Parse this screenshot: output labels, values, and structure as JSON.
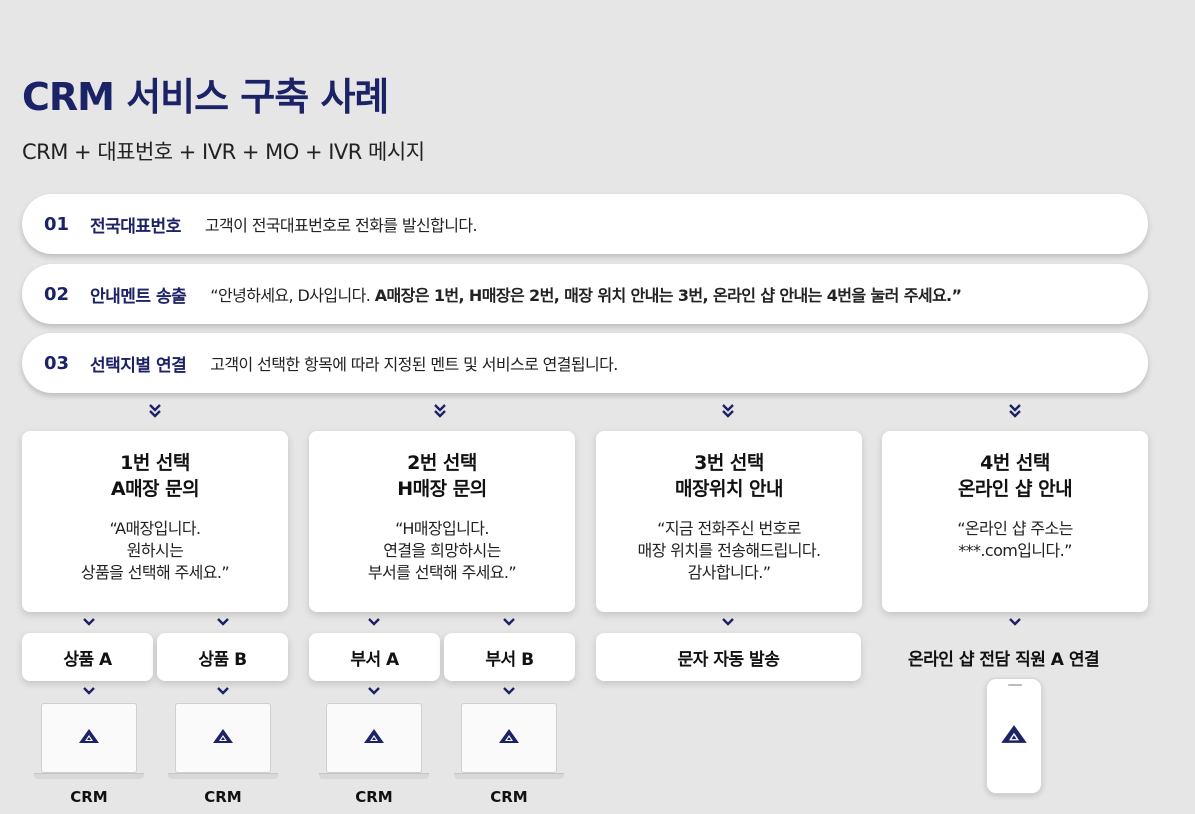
{
  "header": {
    "title": "CRM 서비스 구축 사례",
    "subtitle": "CRM + 대표번호 + IVR + MO + IVR 메시지"
  },
  "steps": [
    {
      "num": "01",
      "label": "전국대표번호",
      "desc": "고객이 전국대표번호로 전화를 발신합니다."
    },
    {
      "num": "02",
      "label": "안내멘트 송출",
      "desc_plain": "“안녕하세요, D사입니다. ",
      "desc_bold": "A매장은 1번, H매장은 2번, 매장 위치 안내는 3번, 온라인 샵 안내는 4번을 눌러 주세요.”"
    },
    {
      "num": "03",
      "label": "선택지별 연결",
      "desc": "고객이 선택한 항목에 따라 지정된 멘트 및 서비스로 연결됩니다."
    }
  ],
  "options": [
    {
      "title1": "1번 선택",
      "title2": "A매장 문의",
      "quote": [
        "“A매장입니다.",
        "원하시는",
        "상품을 선택해 주세요.”"
      ]
    },
    {
      "title1": "2번 선택",
      "title2": "H매장 문의",
      "quote": [
        "“H매장입니다.",
        "연결을 희망하시는",
        "부서를 선택해 주세요.”"
      ]
    },
    {
      "title1": "3번 선택",
      "title2": "매장위치 안내",
      "quote": [
        "“지금 전화주신 번호로",
        "매장 위치를 전송해드립니다.",
        "감사합니다.”"
      ]
    },
    {
      "title1": "4번 선택",
      "title2": "온라인 샵 안내",
      "quote": [
        "“온라인 샵 주소는",
        "***.com입니다.”"
      ]
    }
  ],
  "subs": {
    "a": "상품 A",
    "b": "상품 B",
    "c": "부서 A",
    "d": "부서 B",
    "sms": "문자 자동 발송",
    "online": "온라인 샵 전담 직원 A 연결"
  },
  "crm_label": "CRM",
  "colors": {
    "accent": "#1c2266",
    "background": "#e6e6e6"
  },
  "icons": {
    "logo": "triangle-logo-icon",
    "chevron": "double-chevron-down-icon"
  }
}
